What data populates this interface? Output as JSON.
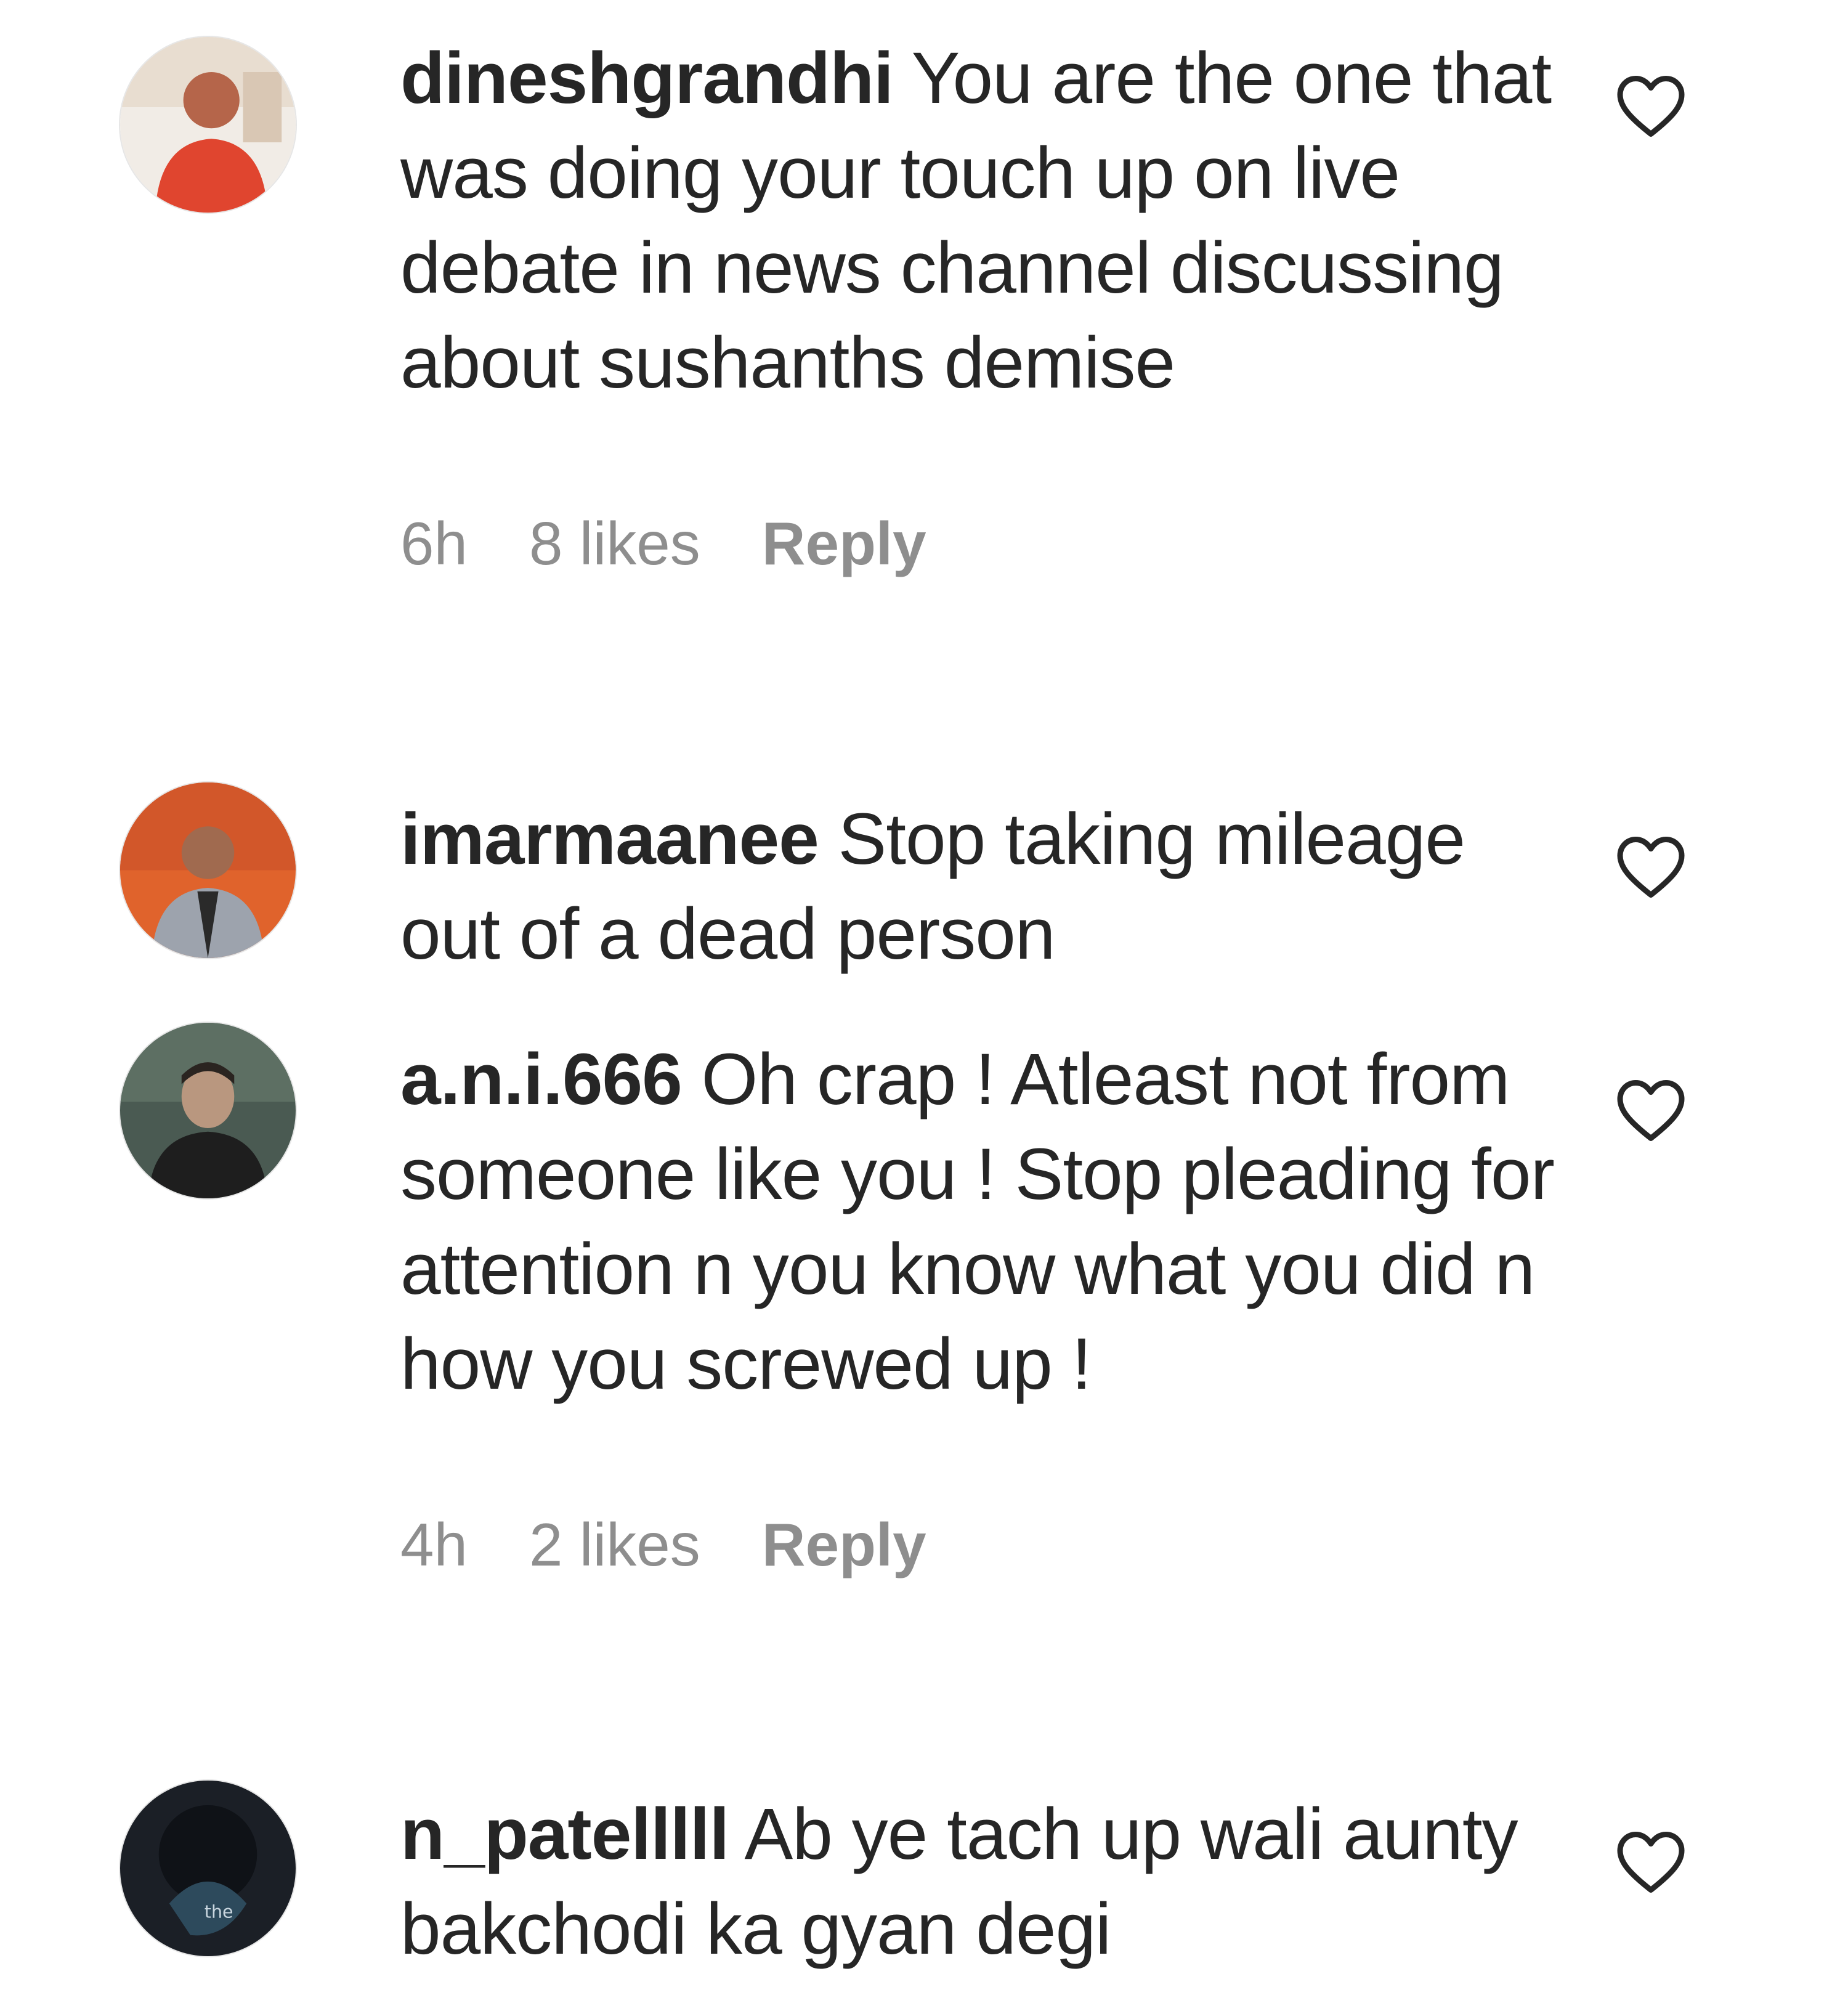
{
  "comments": [
    {
      "username": "dineshgrandhi",
      "text": " You are the one that was doing your touch up on live debate in news channel discussing about sushanths demise",
      "time": "6h",
      "likes": "8 likes",
      "reply_label": "Reply",
      "avatar_icon": "user-avatar-red-shirt",
      "like_icon": "heart-outline-icon"
    },
    {
      "username": "imarmaanee",
      "text": " Stop taking mileage out of a dead person",
      "like_icon": "heart-outline-icon",
      "avatar_icon": "user-avatar-orange-bg"
    },
    {
      "username": "a.n.i.666",
      "text": " Oh crap ! Atleast not from someone like you ! Stop pleading for attention n you know what you did n how you screwed up !",
      "time": "4h",
      "likes": "2 likes",
      "reply_label": "Reply",
      "avatar_icon": "user-avatar-dark",
      "like_icon": "heart-outline-icon"
    },
    {
      "username": "n_patelllll",
      "text": " Ab ye tach up wali aunty bakchodi ka gyan degi",
      "avatar_icon": "user-avatar-night",
      "like_icon": "heart-outline-icon"
    }
  ],
  "colors": {
    "text": "#262626",
    "meta": "#8e8e8e",
    "background": "#ffffff"
  }
}
